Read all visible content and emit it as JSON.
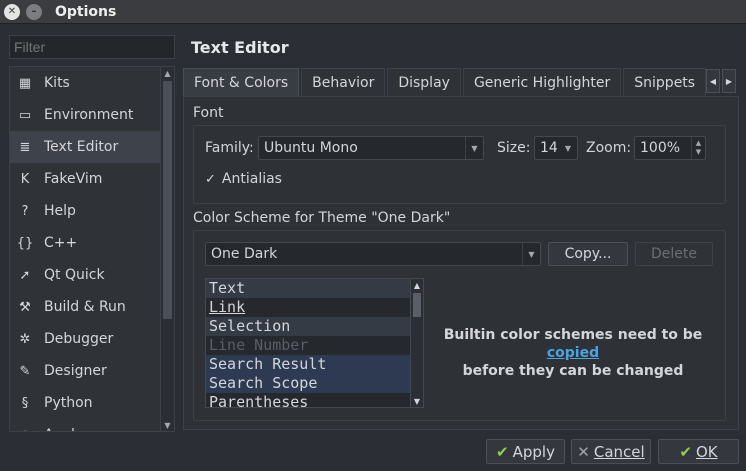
{
  "window": {
    "title": "Options"
  },
  "filter": {
    "placeholder": "Filter"
  },
  "sidebar": {
    "items": [
      {
        "label": "Kits",
        "icon": "kits-icon",
        "glyph": "▦"
      },
      {
        "label": "Environment",
        "icon": "monitor-icon",
        "glyph": "▭"
      },
      {
        "label": "Text Editor",
        "icon": "text-editor-icon",
        "glyph": "≣",
        "active": true
      },
      {
        "label": "FakeVim",
        "icon": "fakevim-icon",
        "glyph": "K"
      },
      {
        "label": "Help",
        "icon": "help-icon",
        "glyph": "?"
      },
      {
        "label": "C++",
        "icon": "braces-icon",
        "glyph": "{}"
      },
      {
        "label": "Qt Quick",
        "icon": "qt-quick-icon",
        "glyph": "➚"
      },
      {
        "label": "Build & Run",
        "icon": "hammer-icon",
        "glyph": "⚒"
      },
      {
        "label": "Debugger",
        "icon": "bug-icon",
        "glyph": "✲"
      },
      {
        "label": "Designer",
        "icon": "pen-icon",
        "glyph": "✎"
      },
      {
        "label": "Python",
        "icon": "python-icon",
        "glyph": "§"
      },
      {
        "label": "Analyzer",
        "icon": "analyzer-icon",
        "glyph": "◔"
      }
    ]
  },
  "page": {
    "title": "Text Editor"
  },
  "tabs": [
    {
      "label": "Font & Colors",
      "active": true
    },
    {
      "label": "Behavior"
    },
    {
      "label": "Display"
    },
    {
      "label": "Generic Highlighter"
    },
    {
      "label": "Snippets"
    }
  ],
  "font_group": {
    "title": "Font",
    "family_label": "Family:",
    "family_value": "Ubuntu Mono",
    "size_label": "Size:",
    "size_value": "14",
    "zoom_label": "Zoom:",
    "zoom_value": "100%",
    "antialias_label": "Antialias",
    "antialias_checked": true
  },
  "scheme_group": {
    "title": "Color Scheme for Theme \"One Dark\"",
    "scheme_value": "One Dark",
    "copy_button": "Copy...",
    "delete_button": "Delete",
    "items": [
      {
        "label": "Text",
        "style": "sel"
      },
      {
        "label": "Link",
        "style": "u"
      },
      {
        "label": "Selection",
        "style": "sel"
      },
      {
        "label": "Line Number",
        "style": "dim"
      },
      {
        "label": "Search Result",
        "style": "hl"
      },
      {
        "label": "Search Scope",
        "style": "hl"
      },
      {
        "label": "Parentheses",
        "style": ""
      }
    ],
    "note_line1_prefix": "Builtin color schemes need to be ",
    "note_link": "copied",
    "note_line2": "before they can be changed"
  },
  "footer": {
    "apply_label": "Apply",
    "cancel_label": "Cancel",
    "ok_label": "OK"
  },
  "colors": {
    "background": "#2b2e34",
    "link": "#4aa3df",
    "ok_check": "#8fd14f"
  }
}
